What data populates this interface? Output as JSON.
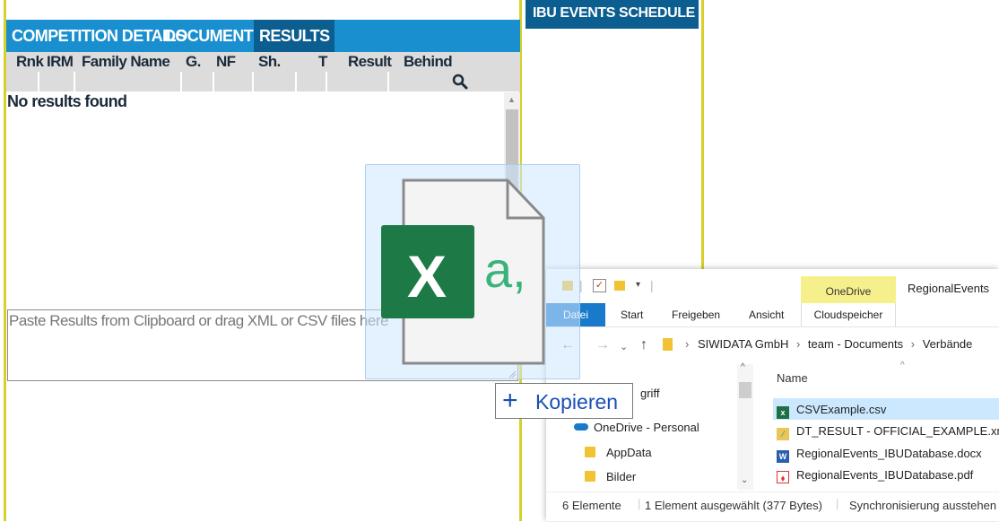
{
  "competition_panel": {
    "tabs": [
      "COMPETITION DETAILS",
      "DOCUMENTS",
      "RESULTS"
    ],
    "active_tab": "RESULTS",
    "columns": [
      "Rnk",
      "IRM",
      "Family Name",
      "G.",
      "NF",
      "Sh.",
      "T",
      "Result",
      "Behind"
    ],
    "empty_message": "No results found",
    "paste_placeholder": "Paste Results from Clipboard or drag XML or CSV files here"
  },
  "events_panel": {
    "title": "IBU EVENTS SCHEDULE"
  },
  "drag": {
    "icon": "excel-csv-file-icon",
    "badge_letter": "X",
    "badge_suffix": "a,",
    "action_symbol": "+",
    "action_label": "Kopieren"
  },
  "explorer": {
    "context_tab": "OneDrive",
    "window_title": "RegionalEvents",
    "ribbon_tabs": [
      "Datei",
      "Start",
      "Freigeben",
      "Ansicht",
      "Cloudspeicher"
    ],
    "breadcrumb": [
      "SIWIDATA GmbH",
      "team - Documents",
      "Verbände"
    ],
    "column_header": "Name",
    "nav_items": [
      {
        "label": "griff",
        "icon": "none"
      },
      {
        "label": "OneDrive - Personal",
        "icon": "cloud-icon"
      },
      {
        "label": "AppData",
        "icon": "folder-icon"
      },
      {
        "label": "Bilder",
        "icon": "folder-icon"
      }
    ],
    "files": [
      {
        "name": "CSVExample.csv",
        "icon": "excel-icon",
        "selected": true
      },
      {
        "name": "DT_RESULT - OFFICIAL_EXAMPLE.xml",
        "icon": "xml-icon",
        "selected": false
      },
      {
        "name": "RegionalEvents_IBUDatabase.docx",
        "icon": "word-icon",
        "selected": false
      },
      {
        "name": "RegionalEvents_IBUDatabase.pdf",
        "icon": "pdf-icon",
        "selected": false
      }
    ],
    "status": {
      "count": "6 Elemente",
      "selection": "1 Element ausgewählt (377 Bytes)",
      "sync": "Synchronisierung ausstehen"
    }
  },
  "colors": {
    "tab_bar": "#1a8fd0",
    "tab_active": "#0b5e8f",
    "frame_yellow": "#d7d02a",
    "explorer_accent": "#1979ca",
    "selection": "#cce8ff"
  }
}
